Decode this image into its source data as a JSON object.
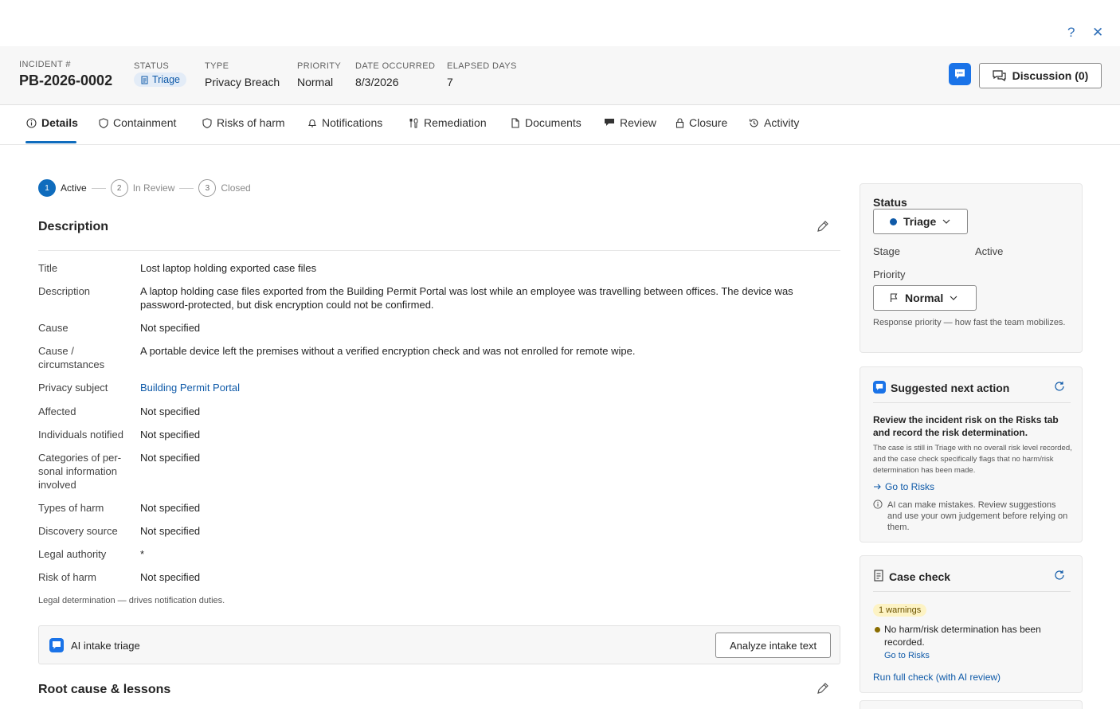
{
  "topbar": {
    "help_label": "?",
    "close_label": "✕"
  },
  "header": {
    "incident": {
      "label": "INCIDENT #",
      "value": "PB-2026-0002"
    },
    "status": {
      "label": "STATUS",
      "value": "Triage"
    },
    "type": {
      "label": "TYPE",
      "value": "Privacy Breach"
    },
    "priority": {
      "label": "PRIORITY",
      "value": "Normal"
    },
    "date_occurred": {
      "label": "DATE OCCURRED",
      "value": "8/3/2026"
    },
    "elapsed_days": {
      "label": "ELAPSED DAYS",
      "value": "7"
    },
    "discussion_label": "Discussion (0)"
  },
  "tabs": [
    {
      "label": "Details",
      "icon": "info-icon"
    },
    {
      "label": "Containment",
      "icon": "shield-icon"
    },
    {
      "label": "Risks of harm",
      "icon": "shield-icon"
    },
    {
      "label": "Notifications",
      "icon": "bell-icon"
    },
    {
      "label": "Remediation",
      "icon": "tools-icon"
    },
    {
      "label": "Documents",
      "icon": "document-icon"
    },
    {
      "label": "Review",
      "icon": "review-icon"
    },
    {
      "label": "Closure",
      "icon": "lock-icon"
    },
    {
      "label": "Activity",
      "icon": "history-icon"
    }
  ],
  "stepper": [
    {
      "num": "1",
      "label": "Active"
    },
    {
      "num": "2",
      "label": "In Review"
    },
    {
      "num": "3",
      "label": "Closed"
    }
  ],
  "description": {
    "title": "Description",
    "rows": [
      {
        "k": "Title",
        "v": "Lost laptop holding exported case files"
      },
      {
        "k": "Description",
        "v": "A laptop holding case files exported from the Building Permit Portal was lost while an employee was travelling between offices. The device was password-protected, but disk encryption could not be confirmed."
      },
      {
        "k": "Cause",
        "v": "Not specified"
      },
      {
        "k": "Cause / circumstances",
        "v": "A portable device left the premises without a verified encryption check and was not enrolled for remote wipe."
      },
      {
        "k": "Privacy subject",
        "v": "Building Permit Portal"
      },
      {
        "k": "Affected",
        "v": "Not specified"
      },
      {
        "k": "Individuals notified",
        "v": "Not specified"
      },
      {
        "k": "Categories of per­sonal information involved",
        "v": "Not specified"
      },
      {
        "k": "Types of harm",
        "v": "Not specified"
      },
      {
        "k": "Discovery source",
        "v": "Not specified"
      },
      {
        "k": "Legal authority",
        "v": "*"
      },
      {
        "k": "Risk of harm",
        "v": "Not specified"
      }
    ],
    "note": "Legal determination — drives notification duties."
  },
  "ai_intake": {
    "label": "AI intake triage",
    "button": "Analyze intake text"
  },
  "root_cause": {
    "title": "Root cause & lessons"
  },
  "status_panel": {
    "status_label": "Status",
    "status_value": "Triage",
    "stage_label": "Stage",
    "stage_value": "Active",
    "priority_label": "Priority",
    "priority_value": "Normal",
    "priority_hint": "Response priority — how fast the team mobilizes."
  },
  "next_action": {
    "title": "Suggested next action",
    "headline": "Review the incident risk on the Risks tab and record the risk determination.",
    "body": "The case is still in Triage with no overall risk level recorded, and the case check specifically flags that no harm/risk determination has been made.",
    "link": "Go to Risks",
    "disclaimer": "AI can make mistakes. Review suggestions and use your own judgement before relying on them."
  },
  "case_check": {
    "title": "Case check",
    "badge": "1 warnings",
    "warning": "No harm/risk determination has been recorded.",
    "warning_link": "Go to Risks",
    "run_link": "Run full check (with AI review)"
  },
  "colors": {
    "accent": "#0f6cbd",
    "ai_blue": "#1a73e8",
    "warning_dot": "#8a6d00",
    "warning_badge_bg": "#fdf3c4"
  }
}
